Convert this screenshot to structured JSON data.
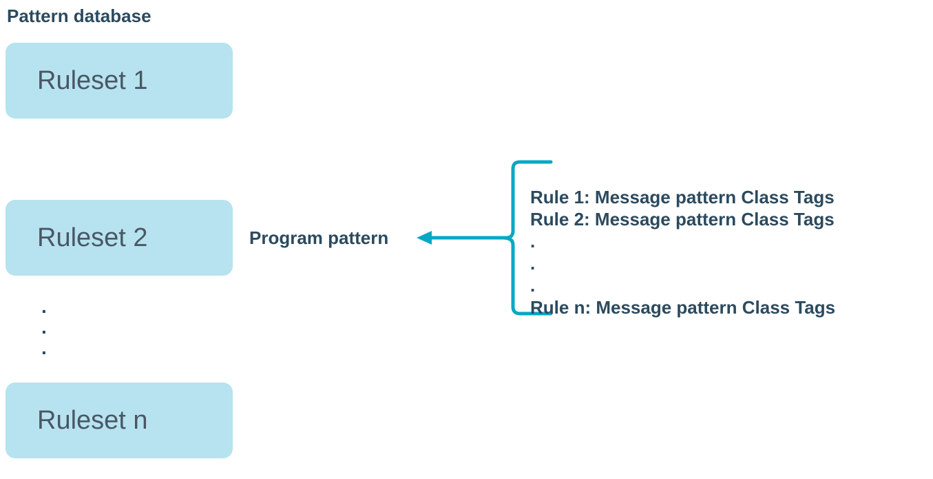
{
  "title": "Pattern database",
  "rulesets": {
    "rs1": "Ruleset 1",
    "rs2": "Ruleset 2",
    "rsn": "Ruleset n"
  },
  "dots_left": ".\n.\n.",
  "program_pattern_label": "Program pattern",
  "rules": {
    "r1": "Rule 1: Message pattern Class Tags",
    "r2": "Rule 2: Message pattern Class Tags",
    "dots": ".\n.\n.",
    "rn": "Rule n: Message pattern Class Tags"
  },
  "colors": {
    "box_bg": "#b6e3ef",
    "text": "#2c4a5e",
    "arrow": "#07a7c6"
  }
}
